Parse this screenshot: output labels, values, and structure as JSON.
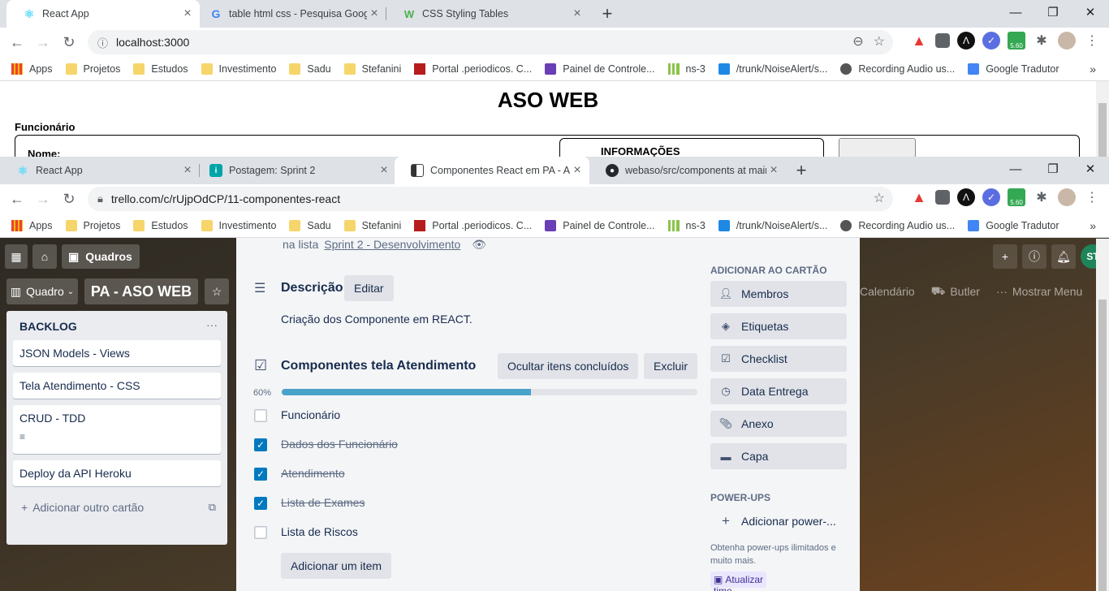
{
  "window1": {
    "tabs": [
      {
        "title": "React App",
        "icon": "react-icon"
      },
      {
        "title": "table html css - Pesquisa Google",
        "icon": "google-icon"
      },
      {
        "title": "CSS Styling Tables",
        "icon": "w3schools-icon"
      }
    ],
    "url": "localhost:3000",
    "page": {
      "heading": "ASO WEB",
      "section_label": "Funcionário",
      "name_label": "Nome:",
      "info_label": "INFORMAÇÕES"
    }
  },
  "window2": {
    "tabs": [
      {
        "title": "React App",
        "icon": "react-icon"
      },
      {
        "title": "Postagem: Sprint 2",
        "icon": "info-icon"
      },
      {
        "title": "Componentes React em PA - ASO",
        "icon": "trello-icon"
      },
      {
        "title": "webaso/src/components at main",
        "icon": "github-icon"
      }
    ],
    "url": "trello.com/c/rUjpOdCP/11-componentes-react"
  },
  "bookmarks": [
    {
      "label": "Apps",
      "icon": "apps-grid-icon"
    },
    {
      "label": "Projetos",
      "icon": "folder-icon"
    },
    {
      "label": "Estudos",
      "icon": "folder-icon"
    },
    {
      "label": "Investimento",
      "icon": "folder-icon"
    },
    {
      "label": "Sadu",
      "icon": "folder-icon"
    },
    {
      "label": "Stefanini",
      "icon": "folder-icon"
    },
    {
      "label": "Portal .periodicos. C...",
      "icon": "periodicos-icon"
    },
    {
      "label": "Painel de Controle...",
      "icon": "painel-icon"
    },
    {
      "label": "ns-3",
      "icon": "ns3-icon"
    },
    {
      "label": "/trunk/NoiseAlert/s...",
      "icon": "trac-icon"
    },
    {
      "label": "Recording Audio us...",
      "icon": "globe-icon"
    },
    {
      "label": "Google Tradutor",
      "icon": "translate-icon"
    }
  ],
  "extension_badge": "5.60",
  "trello": {
    "header": {
      "boards_label": "Quadros",
      "board_btn": "Quadro",
      "board_name": "PA - ASO WEB",
      "right_items": [
        "Calendário",
        "Butler",
        "Mostrar Menu"
      ]
    },
    "list": {
      "title": "BACKLOG",
      "cards": [
        "JSON Models - Views",
        "Tela Atendimento - CSS",
        "CRUD - TDD",
        "Deploy da API Heroku"
      ],
      "add_card": "Adicionar outro cartão"
    },
    "card_modal": {
      "in_list_prefix": "na lista",
      "in_list_link": "Sprint 2 - Desenvolvimento",
      "description_title": "Descrição",
      "edit_button": "Editar",
      "description_text": "Criação dos Componente em REACT.",
      "checklist_title": "Componentes tela Atendimento",
      "hide_done_button": "Ocultar itens concluídos",
      "delete_button": "Excluir",
      "progress_label": "60%",
      "progress": 0.6,
      "items": [
        {
          "label": "Funcionário",
          "done": false
        },
        {
          "label": "Dados dos Funcionário",
          "done": true
        },
        {
          "label": "Atendimento",
          "done": true
        },
        {
          "label": "Lista de Exames",
          "done": true
        },
        {
          "label": "Lista de Riscos",
          "done": false
        }
      ],
      "add_item_button": "Adicionar um item",
      "sidebar": {
        "add_to_card_title": "ADICIONAR AO CARTÃO",
        "buttons": [
          {
            "label": "Membros",
            "icon": "person-icon"
          },
          {
            "label": "Etiquetas",
            "icon": "tag-icon"
          },
          {
            "label": "Checklist",
            "icon": "checklist-icon"
          },
          {
            "label": "Data Entrega",
            "icon": "clock-icon"
          },
          {
            "label": "Anexo",
            "icon": "paperclip-icon"
          },
          {
            "label": "Capa",
            "icon": "card-cover-icon"
          }
        ],
        "powerups_title": "POWER-UPS",
        "add_powerup": "Adicionar power-...",
        "powerups_note": "Obtenha power-ups ilimitados e muito mais.",
        "upgrade_label": "Atualizar time"
      }
    }
  },
  "colors": {
    "trello_blue": "#0079bf",
    "progress": "#49a3c9",
    "chrome_tabstrip": "#dee1e6"
  }
}
